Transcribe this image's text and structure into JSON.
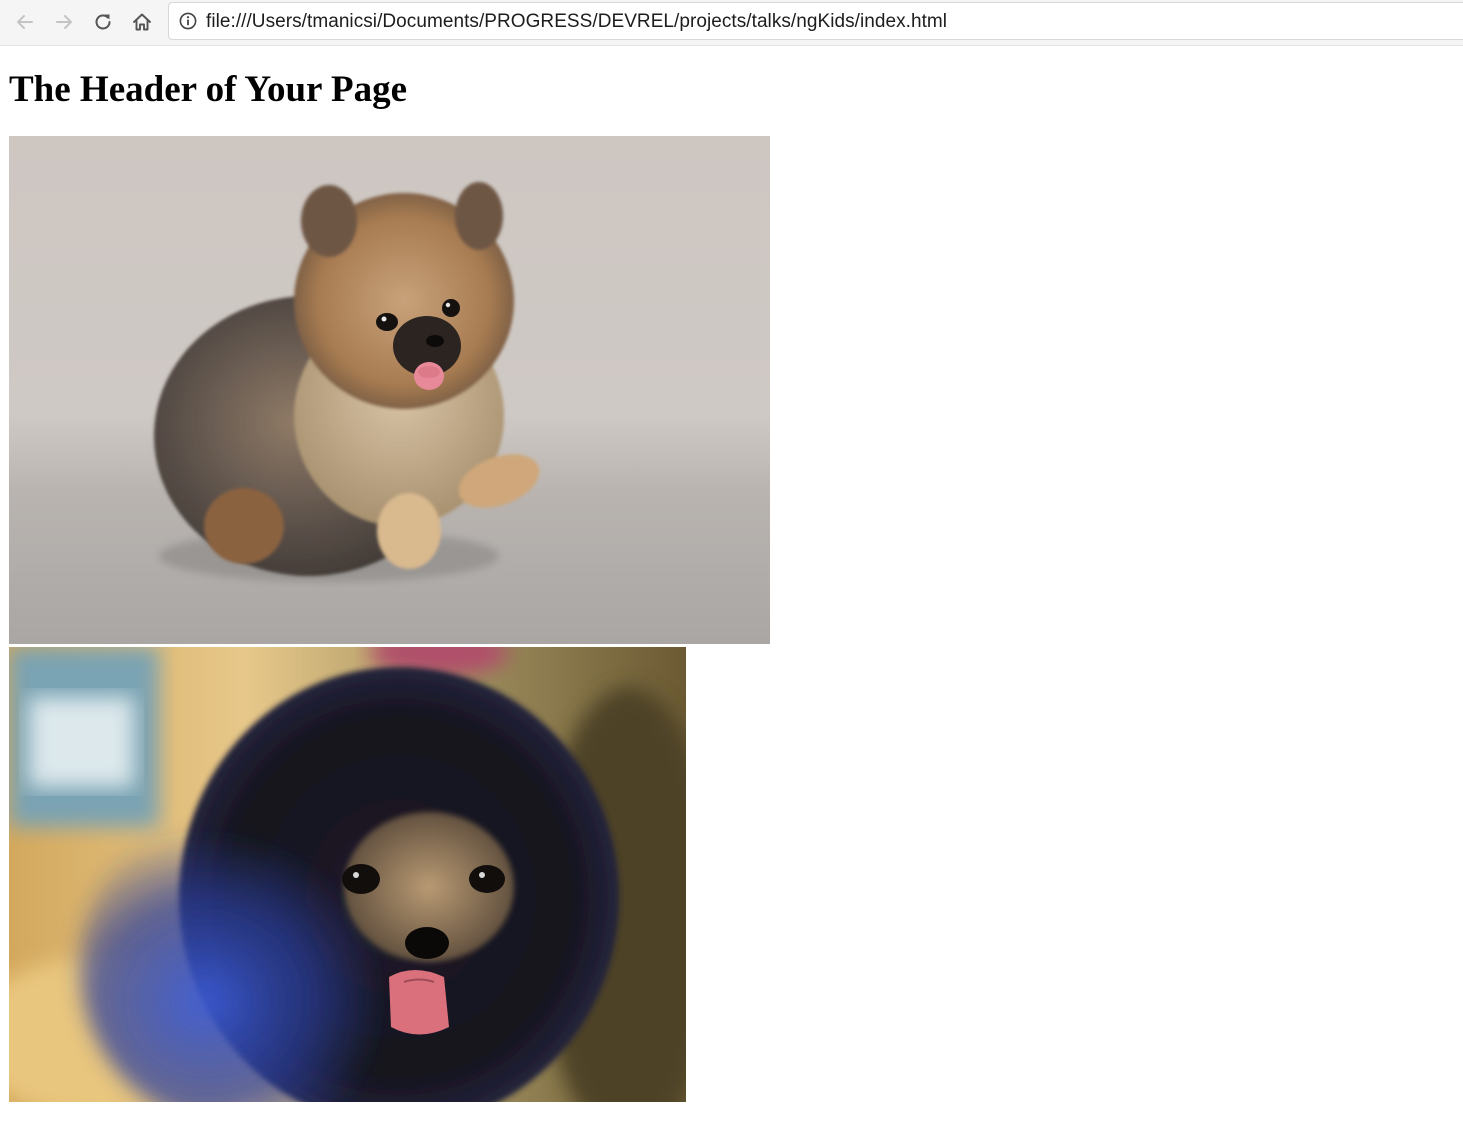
{
  "browser": {
    "back_icon": "arrow-left-icon",
    "forward_icon": "arrow-right-icon",
    "reload_icon": "reload-icon",
    "home_icon": "home-icon",
    "info_icon": "info-icon",
    "url": "file:///Users/tmanicsi/Documents/PROGRESS/DEVREL/projects/talks/ngKids/index.html"
  },
  "page": {
    "header": "The Header of Your Page"
  },
  "colors": {
    "toolbar_bg": "#f5f5f5",
    "page_bg": "#ffffff",
    "header_text": "#000000"
  }
}
